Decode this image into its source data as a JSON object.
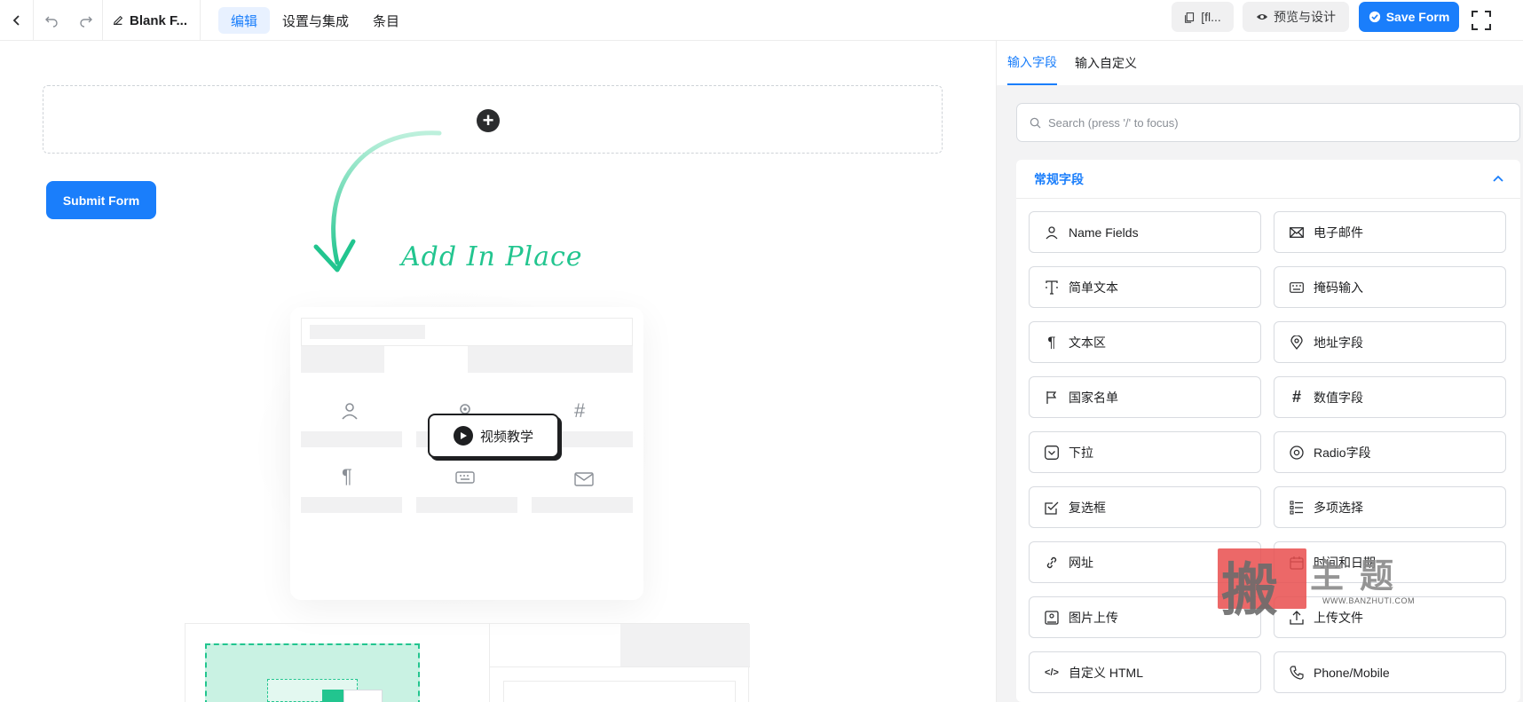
{
  "topbar": {
    "title": "Blank F...",
    "tabs": [
      "编辑",
      "设置与集成",
      "条目"
    ],
    "shortcode_label": "[fl...",
    "preview_label": "预览与设计",
    "save_label": "Save Form"
  },
  "canvas": {
    "submit_label": "Submit Form",
    "add_in_place": "Add In Place",
    "video_label": "视频教学"
  },
  "panel": {
    "tabs": [
      "输入字段",
      "输入自定义"
    ],
    "search_placeholder": "Search (press '/' to focus)",
    "section_title": "常规字段",
    "fields": [
      {
        "label": "Name Fields",
        "icon": "person-icon"
      },
      {
        "label": "电子邮件",
        "icon": "envelope-icon"
      },
      {
        "label": "简单文本",
        "icon": "text-cursor-icon"
      },
      {
        "label": "掩码输入",
        "icon": "keyboard-icon"
      },
      {
        "label": "文本区",
        "icon": "paragraph-icon"
      },
      {
        "label": "地址字段",
        "icon": "map-pin-icon"
      },
      {
        "label": "国家名单",
        "icon": "flag-icon"
      },
      {
        "label": "数值字段",
        "icon": "hash-icon"
      },
      {
        "label": "下拉",
        "icon": "dropdown-icon"
      },
      {
        "label": "Radio字段",
        "icon": "radio-icon"
      },
      {
        "label": "复选框",
        "icon": "checkbox-icon"
      },
      {
        "label": "多项选择",
        "icon": "list-icon"
      },
      {
        "label": "网址",
        "icon": "link-icon"
      },
      {
        "label": "时间和日期",
        "icon": "calendar-icon"
      },
      {
        "label": "图片上传",
        "icon": "image-icon"
      },
      {
        "label": "上传文件",
        "icon": "upload-icon"
      },
      {
        "label": "自定义 HTML",
        "icon": "code-icon"
      },
      {
        "label": "Phone/Mobile",
        "icon": "phone-icon"
      }
    ]
  },
  "watermark": {
    "char": "搬",
    "text": "主题",
    "site": "WWW.BANZHUTI.COM"
  },
  "colors": {
    "accent": "#1a7efb",
    "accent_green": "#22c58f",
    "panel_bg": "#f3f3f4"
  }
}
